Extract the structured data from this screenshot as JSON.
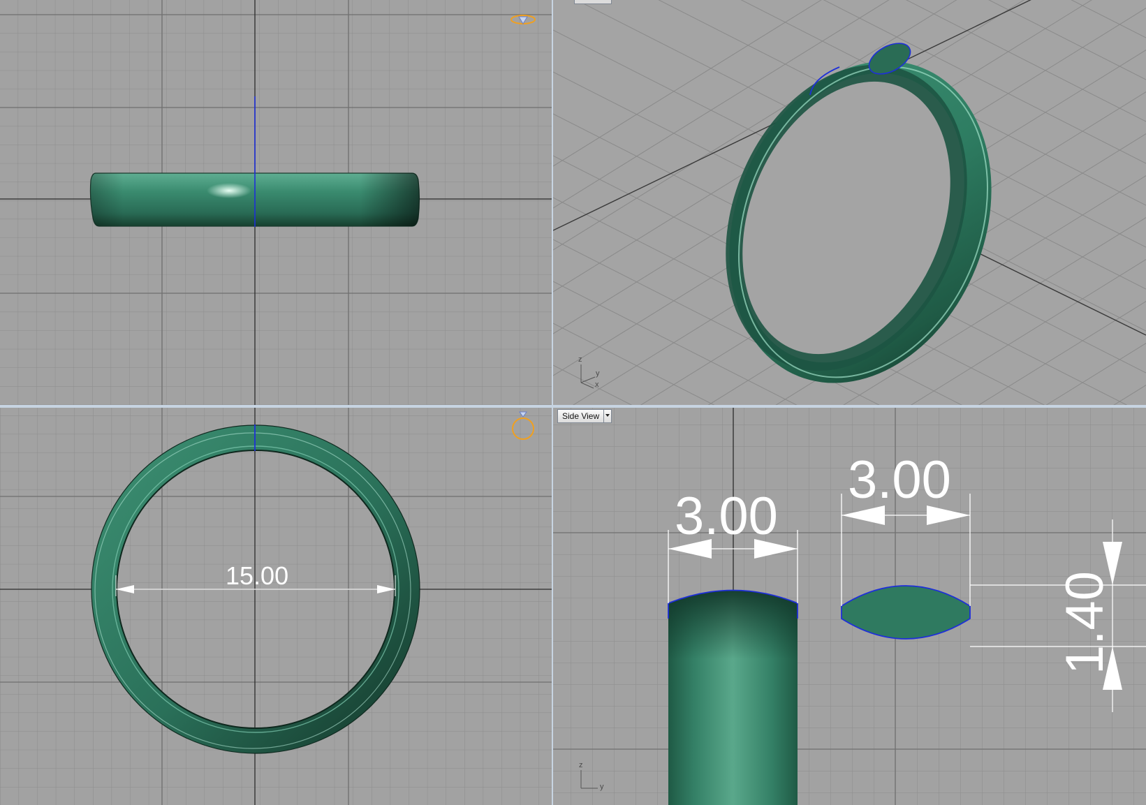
{
  "viewports": {
    "top": {
      "gizmo_icon": "ring-diamond-top-icon"
    },
    "perspective": {
      "axis": {
        "z": "z",
        "y": "y",
        "x": "x"
      }
    },
    "front": {
      "gizmo_icon": "ring-diamond-front-icon",
      "dimension_diameter": "15.00"
    },
    "side": {
      "label": "Side View",
      "dimension_width_1": "3.00",
      "dimension_width_2": "3.00",
      "dimension_height": "1.40",
      "axis": {
        "z": "z",
        "y": "y"
      }
    }
  },
  "colors": {
    "grid_background": "#a2a2a2",
    "ring_color": "#2c7a5e",
    "selection_blue": "#1e2fd8",
    "gizmo_orange": "#f0a020",
    "divider": "#c7d4e2"
  }
}
